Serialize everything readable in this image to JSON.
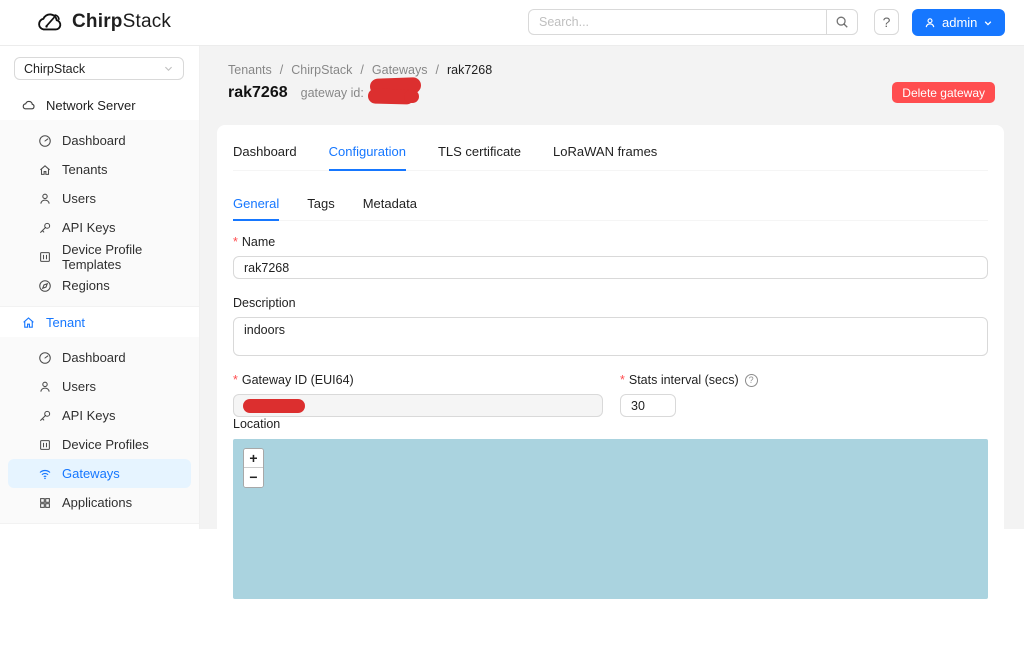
{
  "header": {
    "brand_bold": "Chirp",
    "brand_light": "Stack",
    "search_placeholder": "Search...",
    "help_glyph": "?",
    "user_label": "admin"
  },
  "sidebar": {
    "org_select": "ChirpStack",
    "sections": [
      {
        "label": "Network Server",
        "items": [
          {
            "label": "Dashboard"
          },
          {
            "label": "Tenants"
          },
          {
            "label": "Users"
          },
          {
            "label": "API Keys"
          },
          {
            "label": "Device Profile Templates"
          },
          {
            "label": "Regions"
          }
        ]
      },
      {
        "label": "Tenant",
        "items": [
          {
            "label": "Dashboard"
          },
          {
            "label": "Users"
          },
          {
            "label": "API Keys"
          },
          {
            "label": "Device Profiles"
          },
          {
            "label": "Gateways",
            "selected": true
          },
          {
            "label": "Applications"
          }
        ]
      }
    ]
  },
  "page": {
    "breadcrumb": {
      "items": [
        "Tenants",
        "ChirpStack",
        "Gateways",
        "rak7268"
      ],
      "separator": "/"
    },
    "title": "rak7268",
    "subtitle": "gateway id:",
    "delete_button": "Delete gateway"
  },
  "tabs": {
    "items": [
      "Dashboard",
      "Configuration",
      "TLS certificate",
      "LoRaWAN frames"
    ],
    "active": "Configuration"
  },
  "subtabs": {
    "items": [
      "General",
      "Tags",
      "Metadata"
    ],
    "active": "General"
  },
  "form": {
    "name": {
      "label": "Name",
      "required_mark": "*",
      "value": "rak7268"
    },
    "description": {
      "label": "Description",
      "value": "indoors"
    },
    "gateway_id": {
      "label": "Gateway ID (EUI64)",
      "required_mark": "*",
      "value": ""
    },
    "stats_interval": {
      "label": "Stats interval (secs)",
      "required_mark": "*",
      "tooltip_glyph": "?",
      "value": "30"
    },
    "location": {
      "label": "Location"
    }
  },
  "map": {
    "zoom_in": "+",
    "zoom_out": "−"
  },
  "colors": {
    "accent": "#1677ff",
    "danger": "#ff4d4f",
    "redaction": "#dc2f2f",
    "map_water": "#aad3df",
    "selected_bg": "#e6f4ff"
  }
}
